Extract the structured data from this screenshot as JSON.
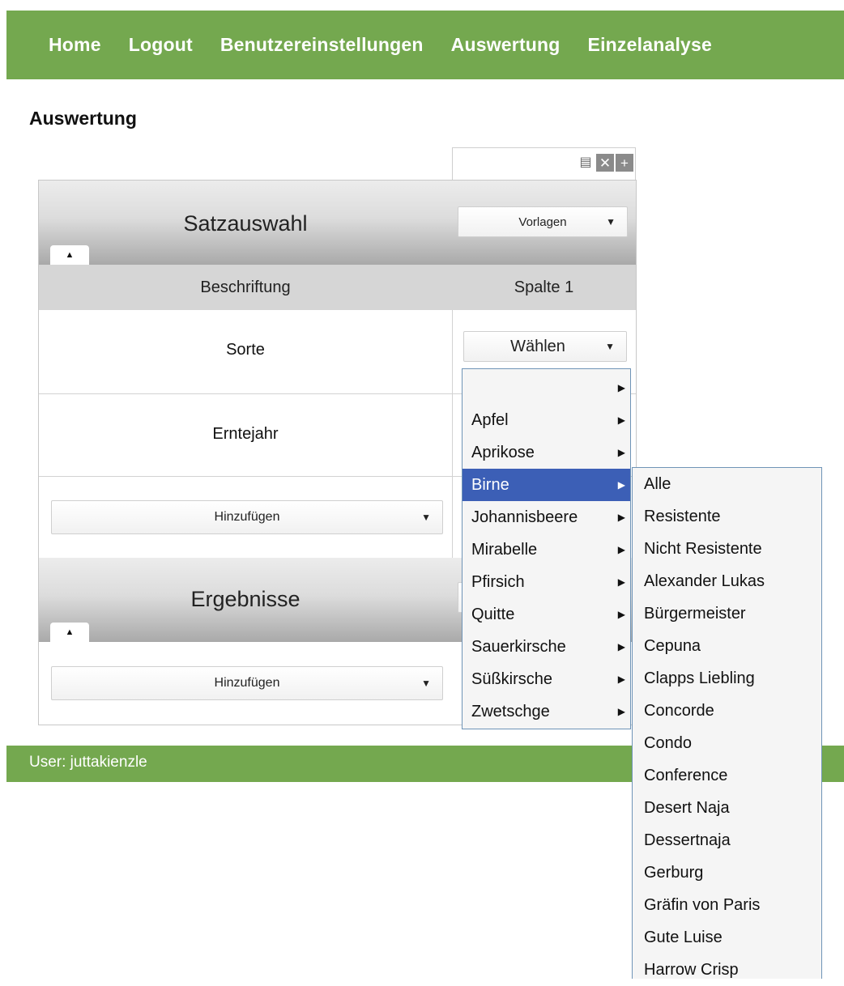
{
  "nav": {
    "items": [
      "Home",
      "Logout",
      "Benutzereinstellungen",
      "Auswertung",
      "Einzelanalyse"
    ]
  },
  "page": {
    "title": "Auswertung"
  },
  "satzauswahl": {
    "title": "Satzauswahl",
    "vorlagen_label": "Vorlagen",
    "col_beschriftung": "Beschriftung",
    "col_spalte": "Spalte 1",
    "rows": [
      {
        "label": "Sorte",
        "value": "Wählen"
      },
      {
        "label": "Erntejahr"
      }
    ],
    "add_label": "Hinzufügen"
  },
  "ergebnisse": {
    "title": "Ergebnisse",
    "add_label": "Hinzufügen"
  },
  "fruit_menu": {
    "items": [
      "",
      "Apfel",
      "Aprikose",
      "Birne",
      "Johannisbeere",
      "Mirabelle",
      "Pfirsich",
      "Quitte",
      "Sauerkirsche",
      "Süßkirsche",
      "Zwetschge"
    ],
    "selected": "Birne"
  },
  "variety_menu": {
    "items": [
      "Alle",
      "Resistente",
      "Nicht Resistente",
      "Alexander Lukas",
      "Bürgermeister",
      "Cepuna",
      "Clapps Liebling",
      "Concorde",
      "Condo",
      "Conference",
      "Desert Naja",
      "Dessertnaja",
      "Gerburg",
      "Gräfin von Paris",
      "Gute Luise",
      "Harrow Crisp"
    ]
  },
  "footer": {
    "user": "User: juttakienzle"
  },
  "colors": {
    "brand_green": "#74a84f",
    "menu_highlight": "#3c5fb6",
    "menu_border": "#6f94b7"
  }
}
